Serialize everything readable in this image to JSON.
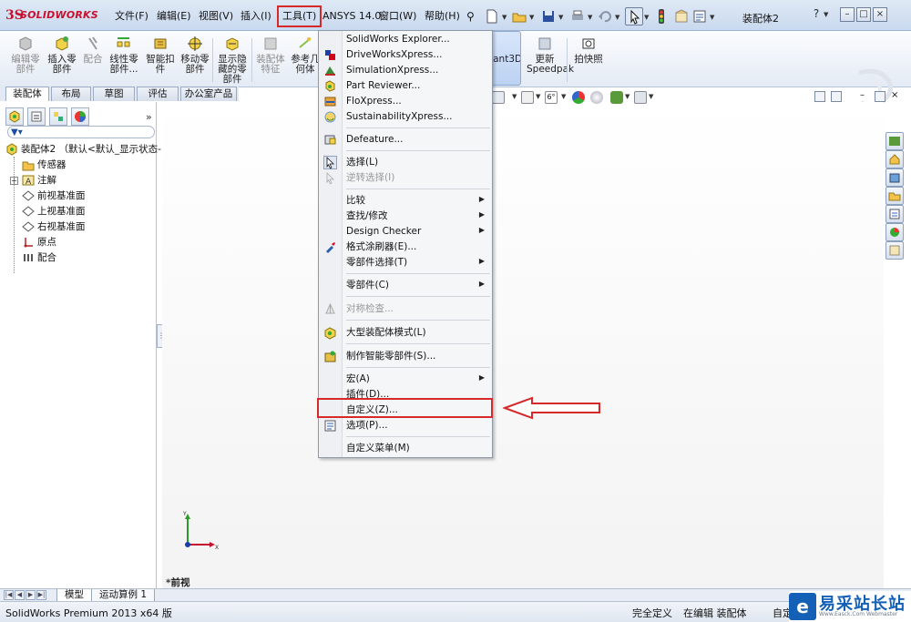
{
  "app": {
    "logo_text": "SOLIDWORKS",
    "document_title": "装配体2"
  },
  "menubar": {
    "file": "文件(F)",
    "edit": "编辑(E)",
    "view": "视图(V)",
    "insert": "插入(I)",
    "tools": "工具(T)",
    "ansys": "ANSYS 14.0",
    "window": "窗口(W)",
    "help": "帮助(H)"
  },
  "window_controls": {
    "help": "?",
    "minimize": "–",
    "restore": "□",
    "close": "×"
  },
  "commandmanager": {
    "edit_component": "编辑零\n部件",
    "insert_component": "插入零\n部件",
    "mate": "配合",
    "linear_pattern": "线性零\n部件...",
    "smart_fasteners": "智能扣\n件",
    "move_component": "移动零\n部件",
    "show_hidden": "显示隐\n藏的零\n部件",
    "assembly_feature": "装配体\n特征",
    "reference_geometry": "参考几\n何体",
    "instant3d": "tant3D",
    "update_speedpak": "更新\nSpeedpak",
    "snapshot": "拍快照"
  },
  "tabs": {
    "assembly": "装配体",
    "layout": "布局",
    "sketch": "草图",
    "evaluate": "评估",
    "office": "办公室产品"
  },
  "tree": {
    "root": "装配体2 （默认<默认_显示状态-",
    "sensors": "传感器",
    "annotations": "注解",
    "front_plane": "前视基准面",
    "top_plane": "上视基准面",
    "right_plane": "右视基准面",
    "origin": "原点",
    "mates": "配合",
    "expand_panel": "»"
  },
  "dropdown": {
    "items": {
      "sw_explorer": "SolidWorks Explorer...",
      "driveworks": "DriveWorksXpress...",
      "simulation": "SimulationXpress...",
      "part_reviewer": "Part Reviewer...",
      "floxpress": "FloXpress...",
      "sustainability": "SustainabilityXpress...",
      "defeature": "Defeature...",
      "select": "选择(L)",
      "reverse_select": "逆转选择(I)",
      "compare": "比较",
      "find_modify": "查找/修改",
      "design_checker": "Design Checker",
      "format_painter": "格式涂刷器(E)...",
      "component_selection": "零部件选择(T)",
      "component": "零部件(C)",
      "symmetry_check": "对称检查...",
      "large_assembly": "大型装配体模式(L)",
      "make_smart": "制作智能零部件(S)...",
      "macro": "宏(A)",
      "addins": "插件(D)...",
      "customize": "自定义(Z)...",
      "options": "选项(P)...",
      "customize_menu": "自定义菜单(M)"
    }
  },
  "graphics": {
    "view_label": "*前视",
    "triad_y": "Y",
    "triad_x": "X"
  },
  "bottom_tabs": {
    "model": "模型",
    "motion_study": "运动算例 1"
  },
  "status": {
    "product": "SolidWorks Premium 2013 x64 版",
    "fully_defined": "完全定义",
    "editing": "在编辑 装配体",
    "custom": "自定"
  },
  "brand": {
    "logo": "e",
    "name": "易采站长站",
    "url": "Www.Easck.Com Webmaster"
  },
  "colors": {
    "highlight_red": "#d62a2a",
    "brand_blue": "#1560b7",
    "solidworks_red": "#c8102e"
  }
}
